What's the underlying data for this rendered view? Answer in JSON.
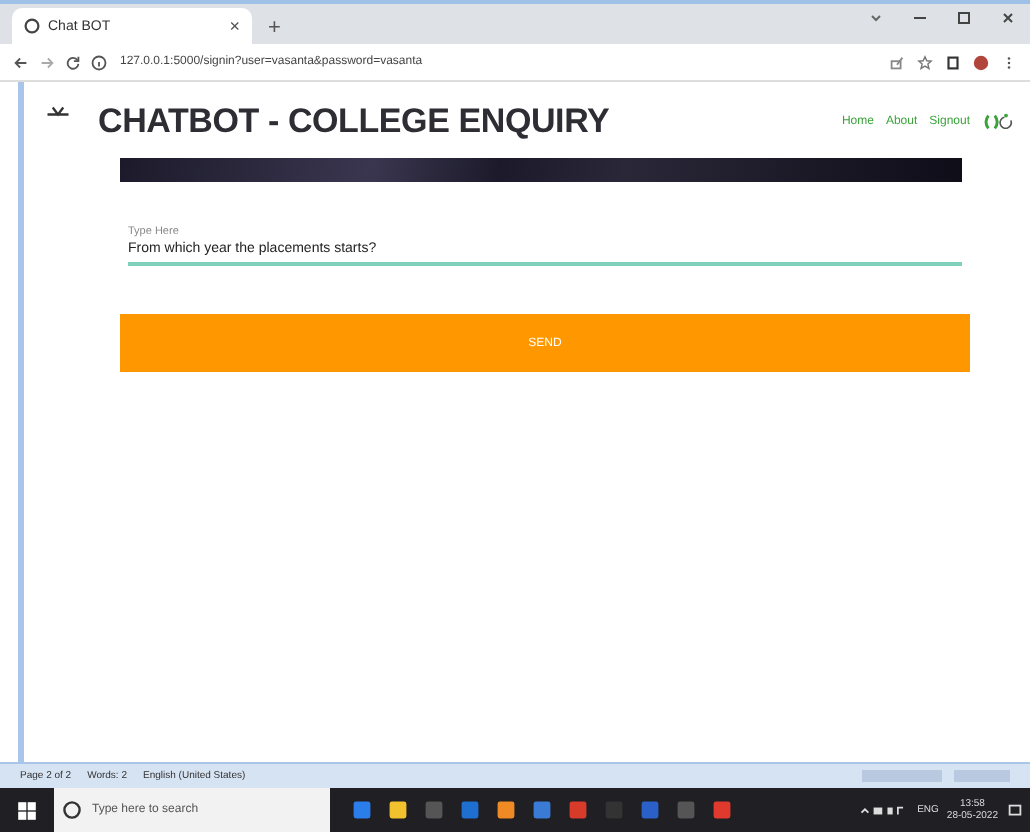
{
  "browser": {
    "tab_title": "Chat BOT",
    "tab_close": "×",
    "new_tab": "+",
    "url": "127.0.0.1:5000/signin?user=vasanta&password=vasanta"
  },
  "header": {
    "title": "CHATBOT - COLLEGE ENQUIRY",
    "nav": [
      {
        "label": "Home"
      },
      {
        "label": "About"
      },
      {
        "label": "Signout"
      }
    ]
  },
  "form": {
    "label": "Type Here",
    "value": "From which year the placements starts?",
    "button": "SEND"
  },
  "word_status": [
    "Page 2 of 2",
    "Words: 2",
    "English (United States)"
  ],
  "taskbar": {
    "search_placeholder": "Type here to search",
    "language": "ENG",
    "time": "13:58",
    "date": "28-05-2022"
  }
}
